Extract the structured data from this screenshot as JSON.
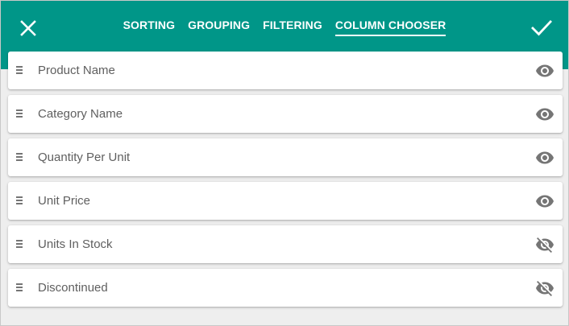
{
  "header": {
    "close_icon": "close-icon",
    "apply_icon": "checkmark-icon",
    "tabs": [
      {
        "label": "SORTING",
        "active": false
      },
      {
        "label": "GROUPING",
        "active": false
      },
      {
        "label": "FILTERING",
        "active": false
      },
      {
        "label": "COLUMN CHOOSER",
        "active": true
      }
    ]
  },
  "columns": [
    {
      "label": "Product Name",
      "visible": true
    },
    {
      "label": "Category Name",
      "visible": true
    },
    {
      "label": "Quantity Per Unit",
      "visible": true
    },
    {
      "label": "Unit Price",
      "visible": true
    },
    {
      "label": "Units In Stock",
      "visible": false
    },
    {
      "label": "Discontinued",
      "visible": false
    }
  ],
  "colors": {
    "accent": "#009688",
    "background": "#eeeeee",
    "icon": "#757575",
    "text": "#5f5f5f"
  }
}
